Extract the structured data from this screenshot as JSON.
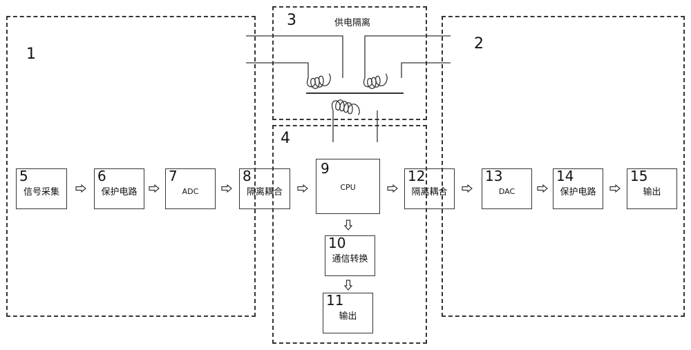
{
  "regions": [
    {
      "id": "1",
      "label": "1"
    },
    {
      "id": "2",
      "label": "2"
    },
    {
      "id": "3",
      "label": "3",
      "title": "供电隔离"
    },
    {
      "id": "4",
      "label": "4"
    }
  ],
  "blocks": {
    "b5": {
      "num": "5",
      "text": "信号采集"
    },
    "b6": {
      "num": "6",
      "text": "保护电路"
    },
    "b7": {
      "num": "7",
      "text": "ADC"
    },
    "b8": {
      "num": "8",
      "text": "隔离耦合"
    },
    "b9": {
      "num": "9",
      "text": "CPU"
    },
    "b12": {
      "num": "12",
      "text": "隔离耦合"
    },
    "b13": {
      "num": "13",
      "text": "DAC"
    },
    "b14": {
      "num": "14",
      "text": "保护电路"
    },
    "b15": {
      "num": "15",
      "text": "输出"
    },
    "b10": {
      "num": "10",
      "text": "通信转换"
    },
    "b11": {
      "num": "11",
      "text": "输出"
    }
  },
  "arrows": [
    {
      "from": "5",
      "to": "6",
      "direction": "right"
    },
    {
      "from": "6",
      "to": "7",
      "direction": "right"
    },
    {
      "from": "7",
      "to": "8",
      "direction": "right"
    },
    {
      "from": "8",
      "to": "9",
      "direction": "right"
    },
    {
      "from": "9",
      "to": "12",
      "direction": "right"
    },
    {
      "from": "12",
      "to": "13",
      "direction": "right"
    },
    {
      "from": "13",
      "to": "14",
      "direction": "right"
    },
    {
      "from": "14",
      "to": "15",
      "direction": "right"
    },
    {
      "from": "9",
      "to": "10",
      "direction": "down"
    },
    {
      "from": "10",
      "to": "11",
      "direction": "down"
    }
  ],
  "transformer": {
    "label": "供电隔离",
    "primary_coils": 2,
    "secondary_coils": 1
  },
  "colors": {
    "line": "#333333",
    "background": "#ffffff"
  }
}
